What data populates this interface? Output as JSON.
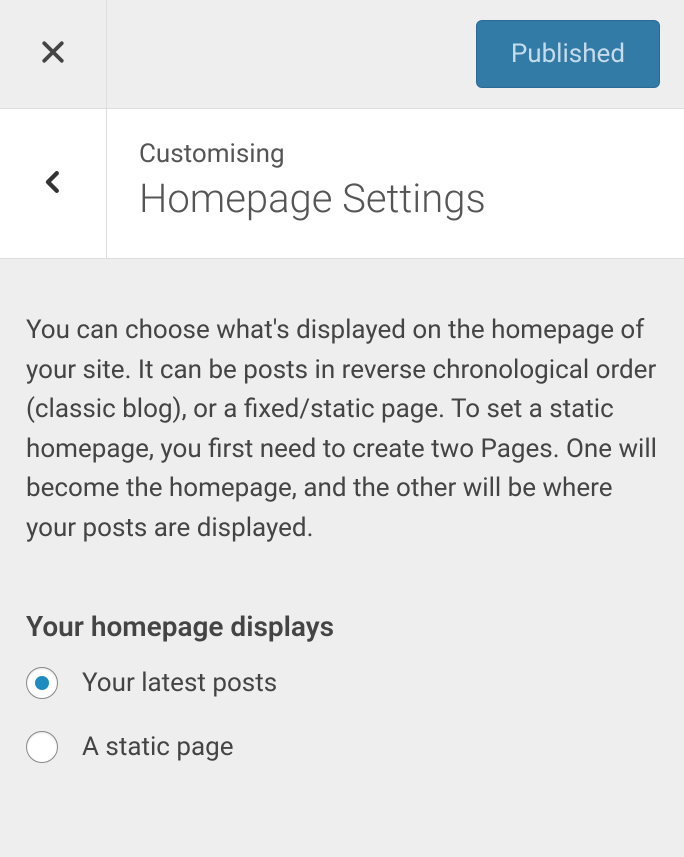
{
  "header": {
    "publish_label": "Published"
  },
  "panel": {
    "breadcrumb": "Customising",
    "title": "Homepage Settings"
  },
  "description": "You can choose what's displayed on the homepage of your site. It can be posts in reverse chronological order (classic blog), or a fixed/static page. To set a static homepage, you first need to create two Pages. One will become the homepage, and the other will be where your posts are displayed.",
  "section": {
    "label": "Your homepage displays",
    "options": [
      {
        "label": "Your latest posts",
        "selected": true
      },
      {
        "label": "A static page",
        "selected": false
      }
    ]
  }
}
